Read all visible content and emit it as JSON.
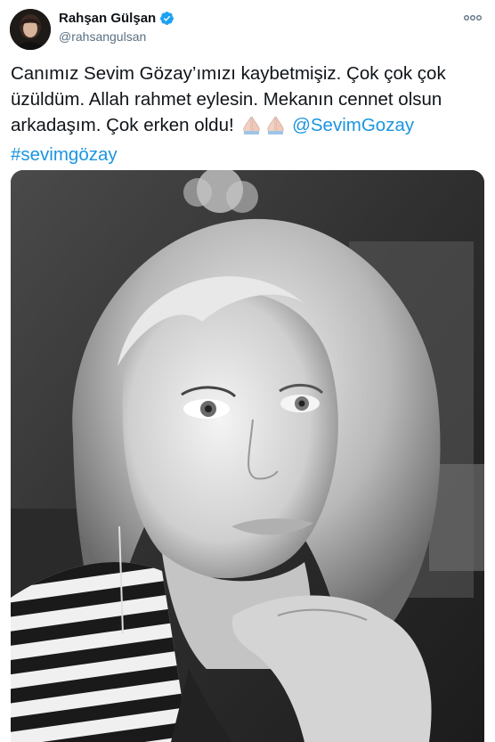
{
  "author": {
    "display_name": "Rahşan Gülşan",
    "handle": "@rahsangulsan",
    "verified_icon": "verified-badge-icon",
    "avatar_icon": "profile-avatar"
  },
  "more_icon": "more-options-icon",
  "tweet": {
    "text_main": "Canımız Sevim Gözay’ımızı kaybetmişiz. Çok çok çok üzüldüm. Allah rahmet eylesin. Mekanın cennet olsun arkadaşım. Çok erken oldu! ",
    "emoji": "🙏🏻🙏🏻",
    "mention": "@SevimGozay",
    "hashtag": "#sevimgözay"
  },
  "media": {
    "type": "photo",
    "subject": "black and white portrait photo"
  },
  "colors": {
    "link": "#1b95e0",
    "verified": "#1da1f2",
    "text": "#0f1419",
    "secondary": "#5b7083"
  }
}
